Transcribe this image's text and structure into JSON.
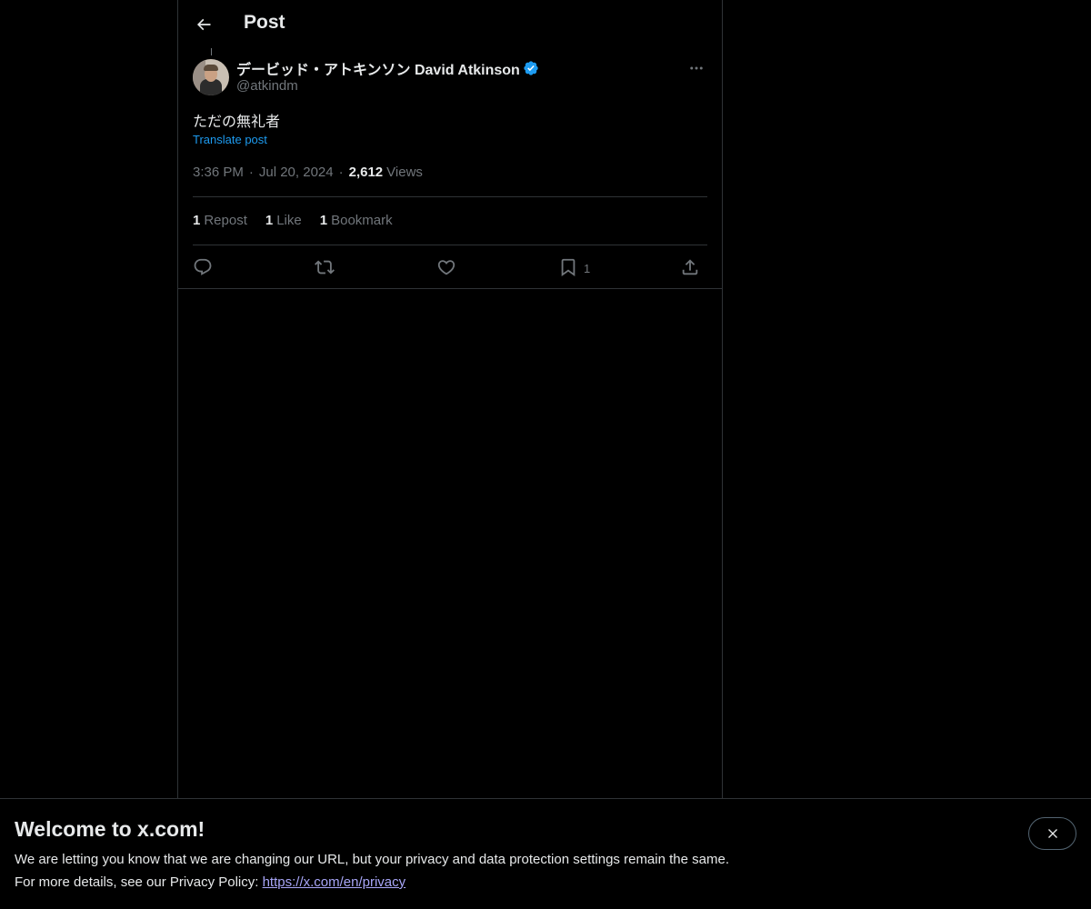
{
  "header": {
    "back_icon": "arrow-left-icon",
    "title": "Post"
  },
  "post": {
    "author": {
      "display_name": "デービッド・アトキンソン David Atkinson",
      "handle": "@atkindm",
      "verified": true,
      "verified_color": "#1d9bf0"
    },
    "text": "ただの無礼者",
    "translate_label": "Translate post",
    "time": "3:36 PM",
    "date": "Jul 20, 2024",
    "views_count": "2,612",
    "views_label": "Views",
    "separator": "·",
    "stats": {
      "reposts": {
        "count": "1",
        "label": "Repost"
      },
      "likes": {
        "count": "1",
        "label": "Like"
      },
      "bookmarks": {
        "count": "1",
        "label": "Bookmark"
      }
    },
    "actions": {
      "reply_icon": "reply-icon",
      "repost_icon": "repost-icon",
      "like_icon": "heart-icon",
      "bookmark_icon": "bookmark-icon",
      "bookmark_count": "1",
      "share_icon": "share-icon"
    }
  },
  "banner": {
    "title": "Welcome to x.com!",
    "line1": "We are letting you know that we are changing our URL, but your privacy and data protection settings remain the same.",
    "line2_prefix": "For more details, see our Privacy Policy: ",
    "link_text": "https://x.com/en/privacy",
    "close_icon": "close-icon"
  },
  "colors": {
    "background": "#000000",
    "text_primary": "#e7e9ea",
    "text_secondary": "#71767b",
    "accent": "#1d9bf0",
    "link": "#a8a6f8",
    "border": "#2f3336"
  }
}
